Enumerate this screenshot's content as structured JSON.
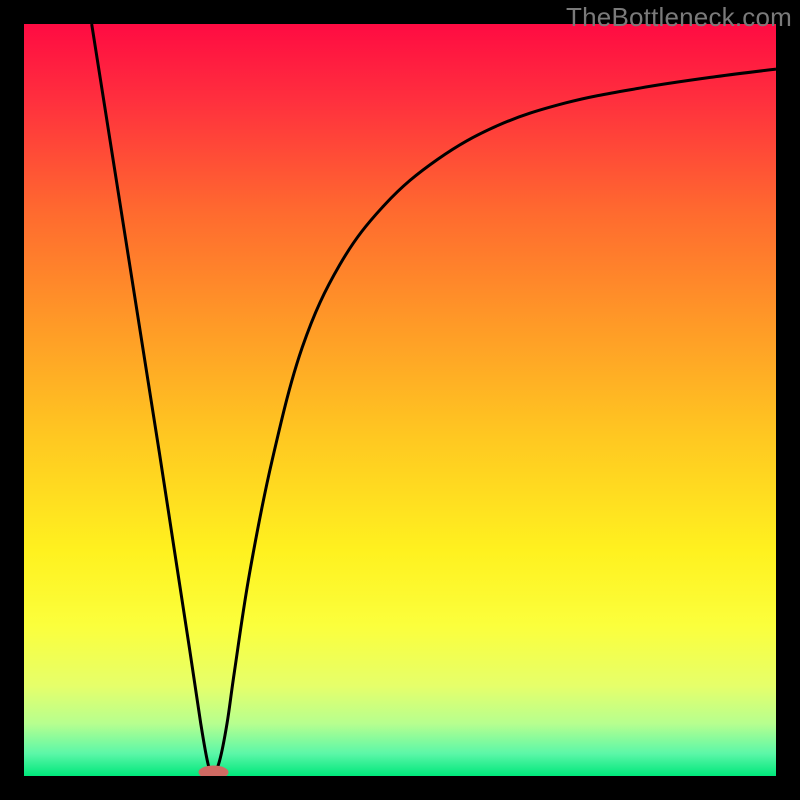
{
  "watermark": "TheBottleneck.com",
  "colors": {
    "frame": "#000000",
    "curve": "#000000",
    "marker_fill": "#cf6a63",
    "gradient_stops": [
      {
        "offset": 0.0,
        "color": "#ff0b42"
      },
      {
        "offset": 0.1,
        "color": "#ff2f3e"
      },
      {
        "offset": 0.25,
        "color": "#ff6a2f"
      },
      {
        "offset": 0.4,
        "color": "#ff9a27"
      },
      {
        "offset": 0.55,
        "color": "#ffc821"
      },
      {
        "offset": 0.7,
        "color": "#fff11f"
      },
      {
        "offset": 0.8,
        "color": "#fbff3c"
      },
      {
        "offset": 0.88,
        "color": "#e6ff6a"
      },
      {
        "offset": 0.93,
        "color": "#b7ff8f"
      },
      {
        "offset": 0.97,
        "color": "#5cf7a8"
      },
      {
        "offset": 1.0,
        "color": "#00e77b"
      }
    ]
  },
  "chart_data": {
    "type": "line",
    "title": "",
    "xlabel": "",
    "ylabel": "",
    "xlim": [
      0,
      100
    ],
    "ylim": [
      0,
      100
    ],
    "grid": false,
    "series": [
      {
        "name": "curve",
        "x": [
          9,
          12,
          15,
          18,
          20,
          22,
          23.5,
          24.5,
          25.2,
          26,
          27,
          28,
          30,
          33,
          37,
          42,
          48,
          55,
          63,
          72,
          82,
          92,
          100
        ],
        "y": [
          100,
          81,
          62,
          43,
          30,
          17,
          7,
          1.5,
          0.5,
          2,
          7,
          14,
          27,
          42,
          57,
          68,
          76,
          82,
          86.5,
          89.5,
          91.5,
          93,
          94
        ]
      }
    ],
    "marker": {
      "x": 25.2,
      "y": 0.5,
      "rx": 2.0,
      "ry": 0.9
    },
    "legend": false
  }
}
